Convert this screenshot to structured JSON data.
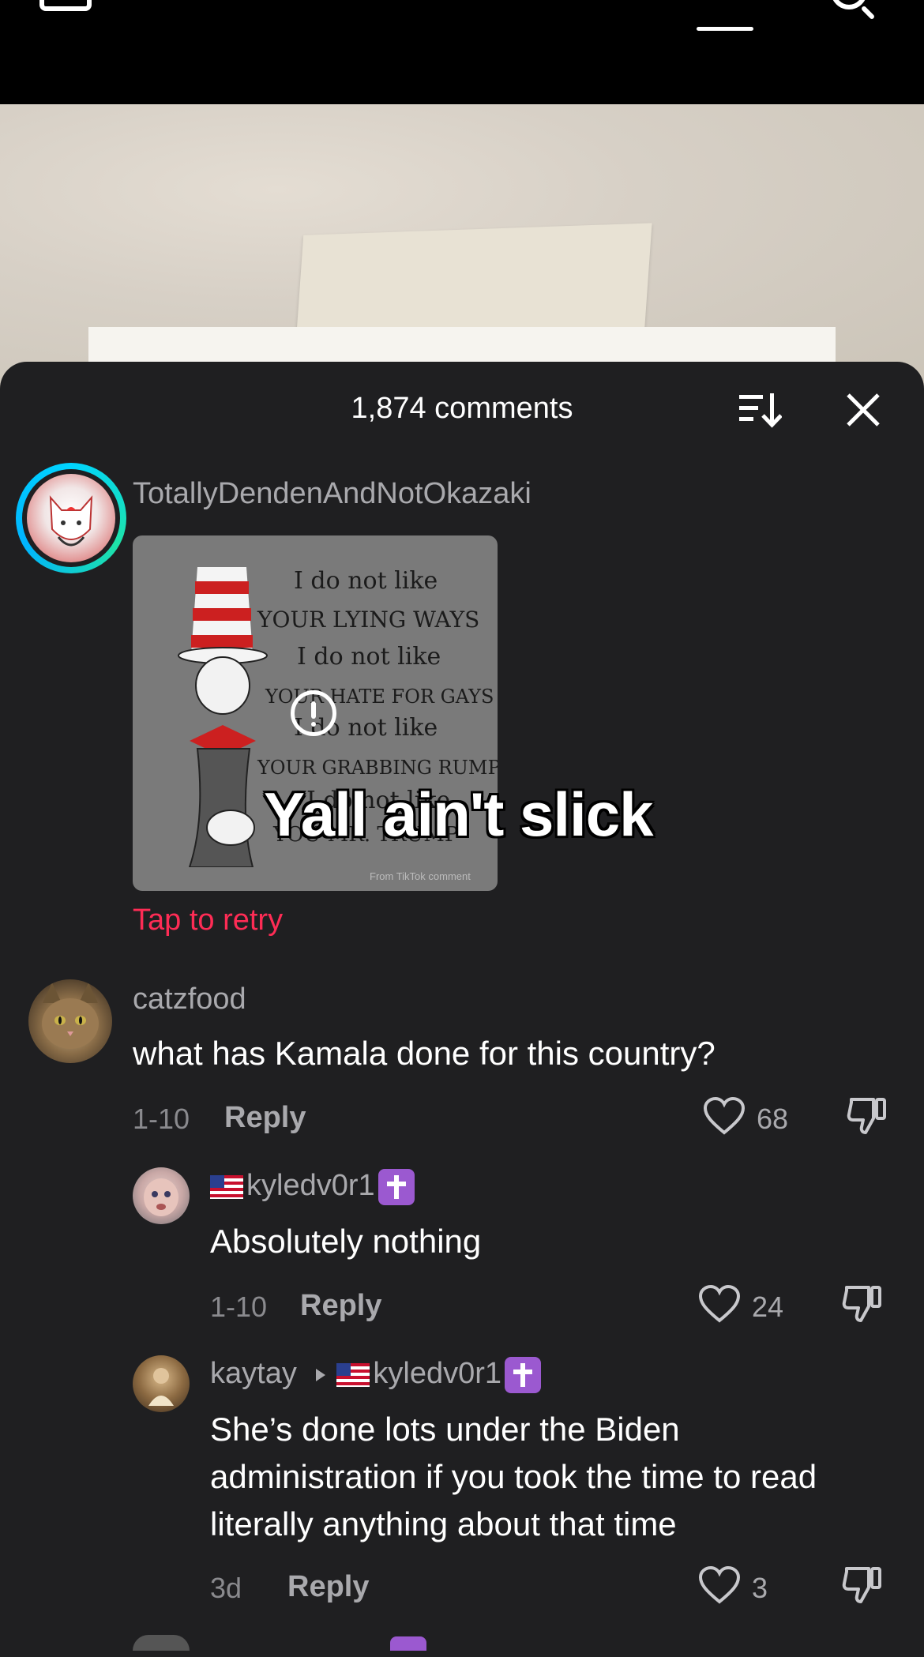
{
  "sheet": {
    "title": "1,874 comments"
  },
  "meme": {
    "lines": [
      "I do not like",
      "YOUR LYING WAYS",
      "I do not like",
      "YOUR HATE FOR GAYS",
      "I do not like",
      "YOUR GRABBING RUMP",
      "I do not like",
      "YOU MR. TRUMP"
    ],
    "watermark": "From TikTok comment",
    "caption": "Yall ain't slick"
  },
  "comments": [
    {
      "username": "TotallyDendenAndNotOkazaki",
      "retry_label": "Tap to retry"
    },
    {
      "username": "catzfood",
      "text": "what has Kamala done for this country?",
      "date": "1-10",
      "reply_label": "Reply",
      "likes": "68"
    },
    {
      "username": "kyledv0r1",
      "text": "Absolutely nothing",
      "date": "1-10",
      "reply_label": "Reply",
      "likes": "24"
    },
    {
      "username": "kaytay",
      "reply_to": "kyledv0r1",
      "text": "She’s done lots under the Biden administration if you took the time to read literally anything about that time",
      "date": "3d",
      "reply_label": "Reply",
      "likes": "3"
    }
  ],
  "colors": {
    "sheet_bg": "#1f1f21",
    "accent_red": "#fe2c55",
    "badge_purple": "#9b59d0"
  }
}
